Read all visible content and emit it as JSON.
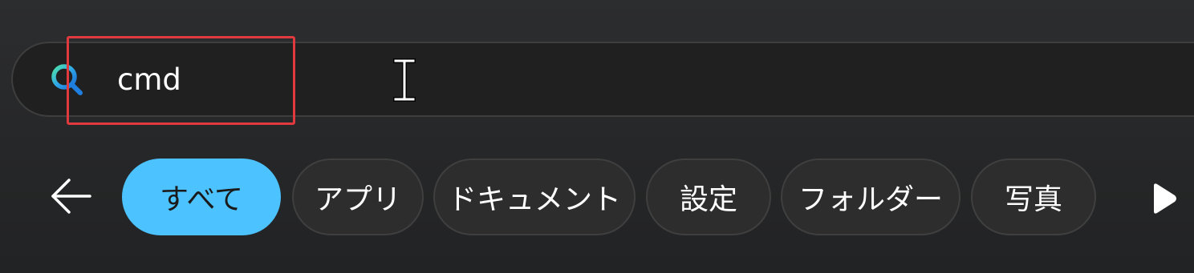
{
  "search": {
    "query": "cmd",
    "icon": "search-icon"
  },
  "filters": {
    "back_icon": "back-arrow-icon",
    "scroll_icon": "chevron-right-icon",
    "items": [
      {
        "label": "すべて",
        "active": true
      },
      {
        "label": "アプリ",
        "active": false
      },
      {
        "label": "ドキュメント",
        "active": false
      },
      {
        "label": "設定",
        "active": false
      },
      {
        "label": "フォルダー",
        "active": false
      },
      {
        "label": "写真",
        "active": false
      }
    ]
  },
  "colors": {
    "accent": "#4cc2ff",
    "highlight": "#e03a3f",
    "chip_background": "#2d2d2d",
    "search_background": "#202020"
  }
}
